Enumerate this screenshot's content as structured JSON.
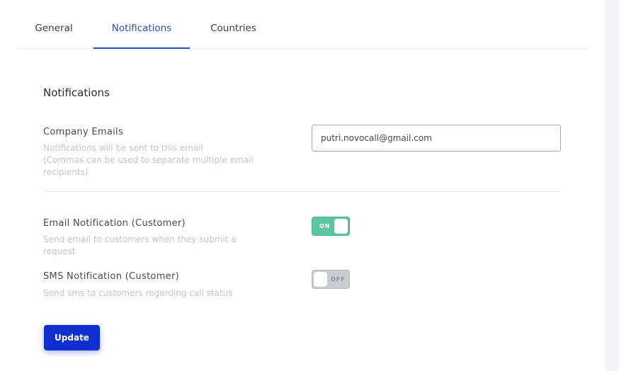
{
  "tabs": [
    {
      "label": "General",
      "active": false
    },
    {
      "label": "Notifications",
      "active": true
    },
    {
      "label": "Countries",
      "active": false
    }
  ],
  "section": {
    "title": "Notifications"
  },
  "company_emails": {
    "label": "Company Emails",
    "help_line1": "Notifications will be sent to this email",
    "help_line2": "(Commas can be used to separate multiple email",
    "help_line3": "recipients)",
    "value": "putri.novocall@gmail.com"
  },
  "email_notification": {
    "label": "Email Notification (Customer)",
    "help": "Send email to customers when they submit a request",
    "toggle_text": "ON",
    "enabled": true
  },
  "sms_notification": {
    "label": "SMS Notification (Customer)",
    "help": "Send sms to customers regarding call status",
    "toggle_text": "OFF",
    "enabled": false
  },
  "actions": {
    "update_label": "Update"
  },
  "colors": {
    "accent": "#2b4bc4",
    "button": "#0f2fd1",
    "toggle_on": "#5cc6a0",
    "toggle_off": "#c9cbd1"
  }
}
